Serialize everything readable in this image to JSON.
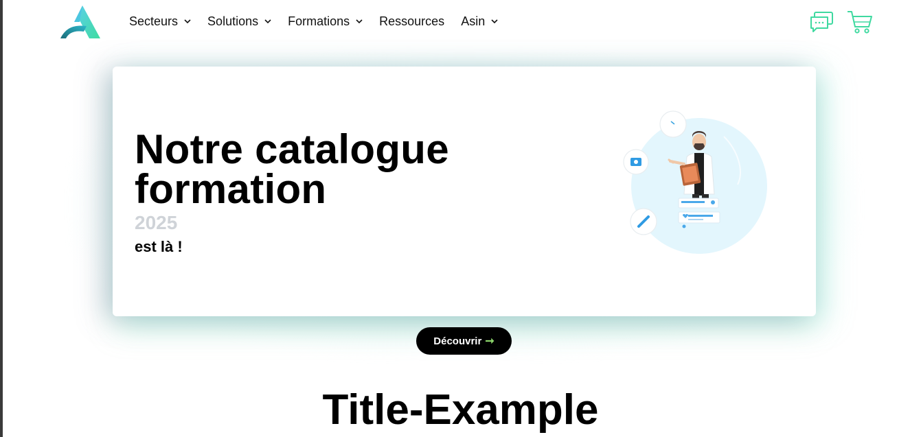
{
  "header": {
    "nav": [
      {
        "label": "Secteurs",
        "dropdown": true
      },
      {
        "label": "Solutions",
        "dropdown": true
      },
      {
        "label": "Formations",
        "dropdown": true
      },
      {
        "label": "Ressources",
        "dropdown": false
      },
      {
        "label": "Asin",
        "dropdown": true
      }
    ],
    "icons": [
      "logo-icon",
      "chat-icon",
      "cart-icon"
    ]
  },
  "hero": {
    "title_line1": "Notre catalogue",
    "title_line2": "formation",
    "year": "2025",
    "subtitle": "est là !",
    "cta_label": "Découvrir",
    "cta_arrow": "➞"
  },
  "section": {
    "title": "Title-Example"
  },
  "colors": {
    "accent": "#3fd9a0",
    "arrow": "#8bd46b",
    "button_bg": "#000000",
    "year_text": "#cfd3d8"
  }
}
